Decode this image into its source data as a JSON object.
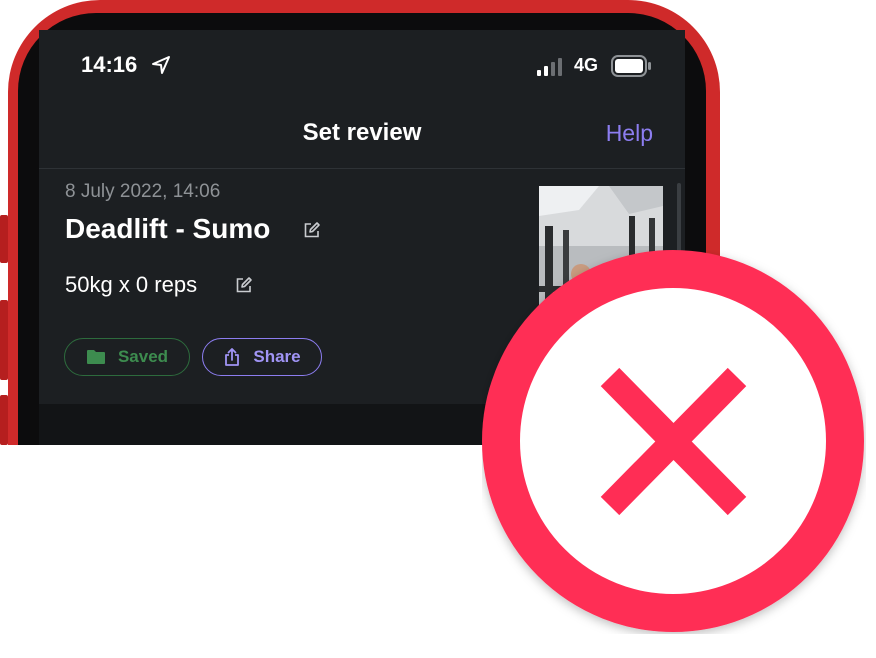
{
  "status": {
    "time": "14:16",
    "network": "4G"
  },
  "nav": {
    "title": "Set review",
    "help_label": "Help"
  },
  "set": {
    "date": "8 July 2022, 14:06",
    "exercise": "Deadlift - Sumo",
    "weight_reps": "50kg x 0 reps",
    "saved_label": "Saved",
    "share_label": "Share"
  },
  "icons": [
    "location-arrow-icon",
    "signal-bars-icon",
    "battery-icon",
    "edit-icon",
    "folder-icon",
    "share-icon",
    "error-cross-icon"
  ],
  "colors": {
    "accent": "#8c7df0",
    "saved": "#3d8c4f",
    "background": "#1c1f22",
    "error": "#ff2d55",
    "frame": "#cf2a2a"
  }
}
